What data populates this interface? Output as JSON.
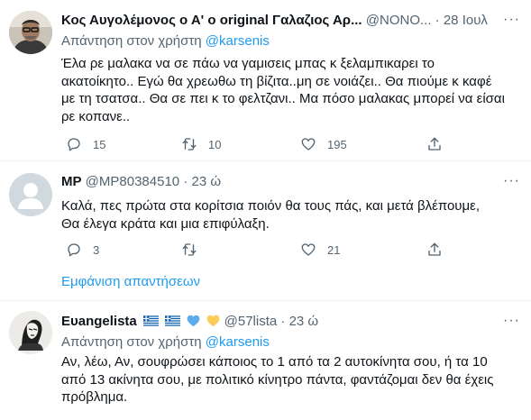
{
  "tweets": [
    {
      "name": "Κος Αυγολέμονος ο Α' ο original Γαλαζιος Αρ...",
      "handle": "@ΝΟΝΟ...",
      "dot": "·",
      "time": "28 Ιουλ",
      "more": "···",
      "reply_prefix": "Απάντηση στον χρήστη",
      "reply_mention": "@karsenis",
      "lines": [
        "Έλα ρε μαλακα να σε πάω να γαμισεις μπας κ ξελαμπικαρει το",
        "ακατοίκητο.. Εγώ θα χρεωθω τη βίζιτα..μη σε νοιάζει.. Θα πιούμε κ καφέ",
        "με τη τσατσα.. Θα σε πει κ το φελτζανι.. Μα πόσο μαλακας μπορεί να είσαι",
        "ρε κοπανε.."
      ],
      "replies": "15",
      "retweets": "10",
      "likes": "195"
    },
    {
      "name": "MP",
      "handle": "@MP80384510",
      "dot": "·",
      "time": "23 ώ",
      "more": "···",
      "lines": [
        "Καλά, πες πρώτα στα κορίτσια ποιόν θα τους πάς, και μετά βλέπουμε,",
        "Θα έλεγα κράτα και μια επιφύλαξη."
      ],
      "replies": "3",
      "retweets": "",
      "likes": "21",
      "show_replies": "Εμφάνιση απαντήσεων"
    },
    {
      "name": "Ευangelista",
      "handle": "@57lista",
      "dot": "·",
      "time": "23 ώ",
      "more": "···",
      "reply_prefix": "Απάντηση στον χρήστη",
      "reply_mention": "@karsenis",
      "lines": [
        "Αν, λέω, Αν, σουφρώσει κάποιος το 1 από τα 2 αυτοκίνητα σου, ή τα 10",
        "από 13 ακίνητα σου, με πολιτικό κίνητρο πάντα, φαντάζομαι δεν θα έχεις",
        "πρόβλημα."
      ]
    }
  ],
  "icons": {
    "reply": "reply-icon",
    "retweet": "retweet-icon",
    "like": "heart-icon",
    "share": "share-icon",
    "more": "more-icon",
    "flag": "greek-flag-icon",
    "blue_heart": "blue-heart-icon",
    "yellow_heart": "yellow-heart-icon"
  },
  "colors": {
    "accent": "#1d9bf0",
    "secondary_text": "#536471",
    "divider": "#eff3f4"
  }
}
